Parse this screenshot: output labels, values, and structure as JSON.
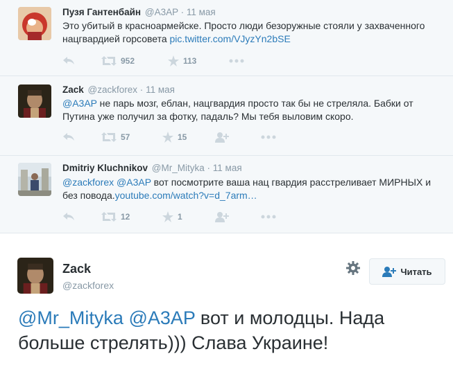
{
  "tweets": [
    {
      "name": "Пузя Гантенбайн",
      "handle": "@A3AP",
      "dot": "·",
      "time": "11 мая",
      "text_plain": "Это убитый в красноармейске. Просто люди безоружные стояли у захваченного нацгвардией горсовета ",
      "link": "pic.twitter.com/VJyzYn2bSE",
      "retweets": "952",
      "favorites": "113"
    },
    {
      "name": "Zack",
      "handle": "@zackforex",
      "dot": "·",
      "time": "11 мая",
      "mention": "@A3AP",
      "text_plain": " не парь мозг, еблан, нацгвардия просто так бы не стреляла. Бабки от Путина уже получил за фотку, падаль? Мы тебя выловим скоро.",
      "retweets": "57",
      "favorites": "15"
    },
    {
      "name": "Dmitriy Kluchnikov",
      "handle": "@Mr_Mityka",
      "dot": "·",
      "time": "11 мая",
      "mention1": "@zackforex",
      "mention2": "@A3AP",
      "text_plain": " вот посмотрите ваша нац гвардия расстреливает МИРНЫХ и без повода.",
      "link": "youtube.com/watch?v=d_7arm…",
      "retweets": "12",
      "favorites": "1"
    }
  ],
  "main_tweet": {
    "name": "Zack",
    "handle": "@zackforex",
    "follow_label": "Читать",
    "mention1": "@Mr_Mityka",
    "mention2": "@A3AP",
    "text_plain": " вот и молодцы. Нада больше стрелять))) Слава Украине!"
  },
  "colors": {
    "link": "#2b7bb9",
    "meta": "#8899a6",
    "text": "#292f33",
    "background_reply": "#f5f8fa"
  },
  "icons": [
    "reply-icon",
    "retweet-icon",
    "favorite-icon",
    "follow-icon",
    "more-icon",
    "gear-icon"
  ]
}
